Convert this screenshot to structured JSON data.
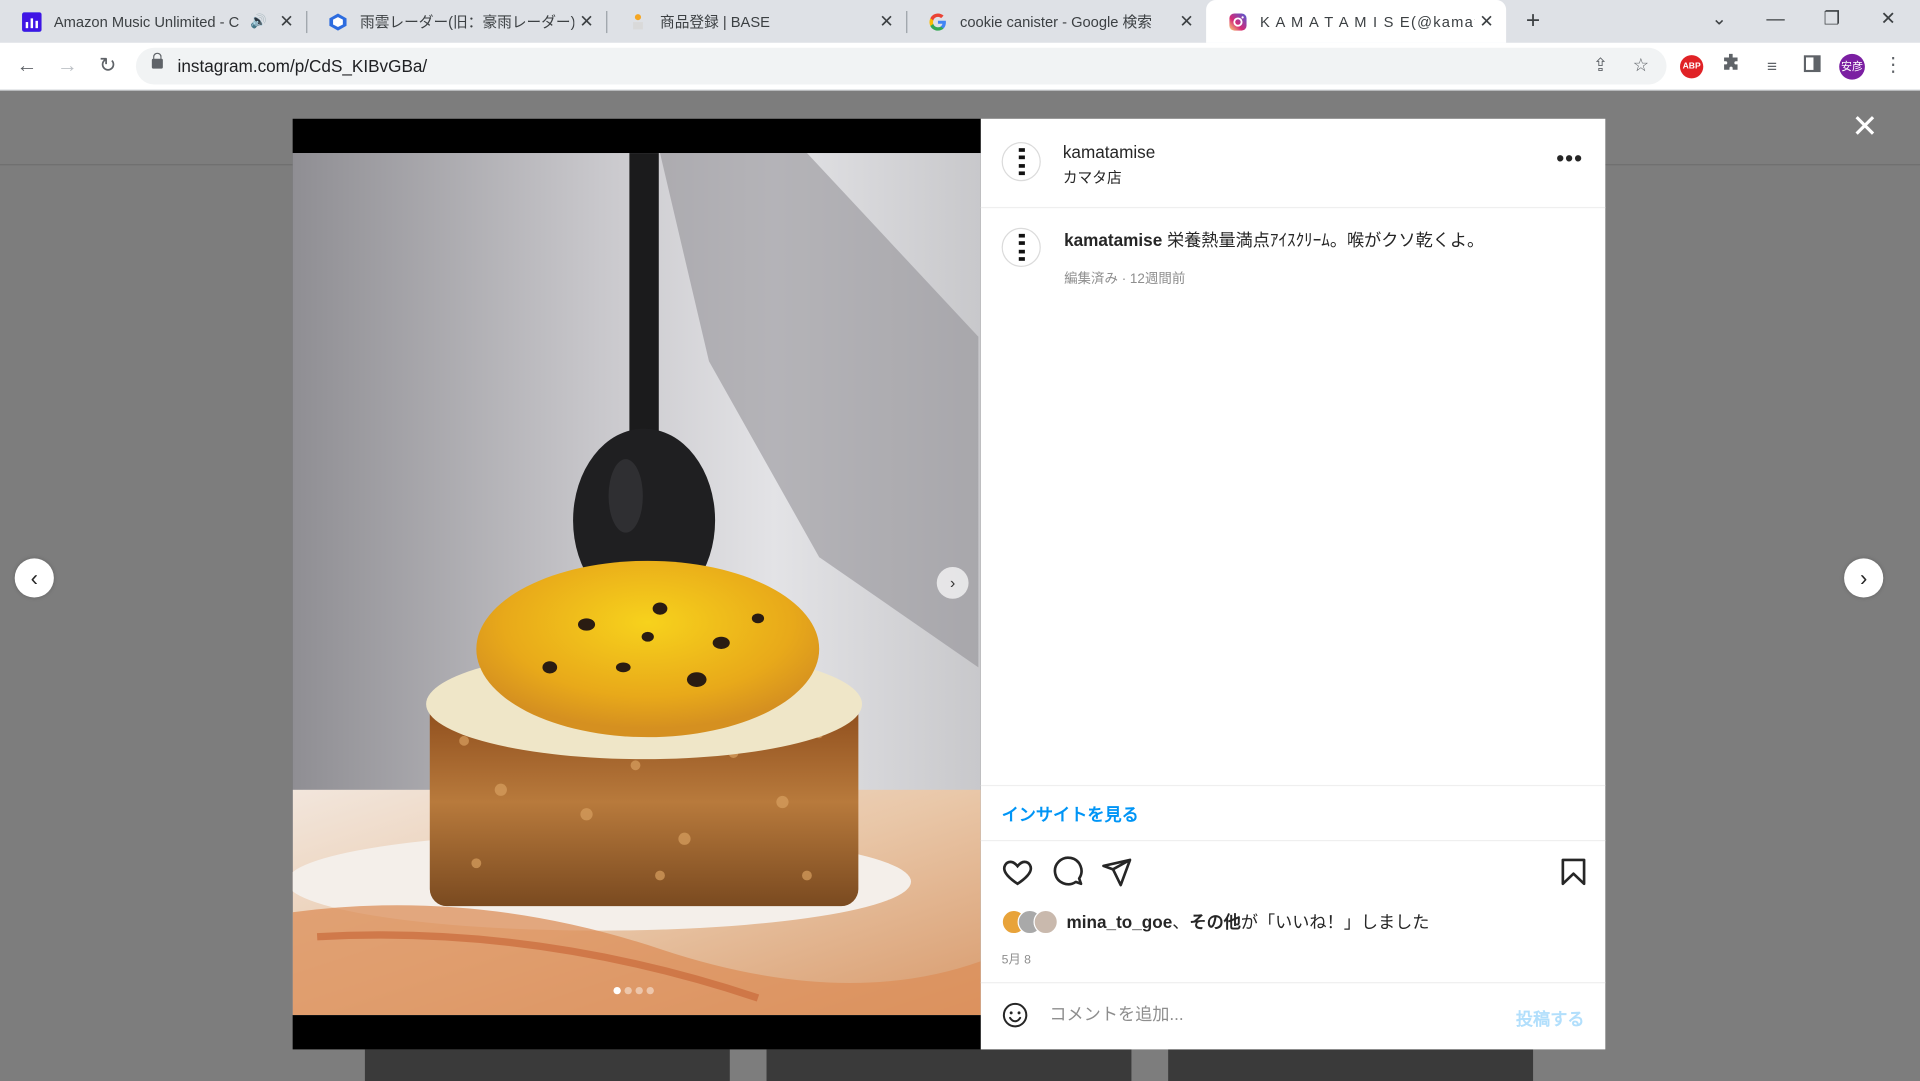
{
  "browser": {
    "tabs": [
      {
        "title": "Amazon Music Unlimited - C",
        "icon": "amazon-music-icon"
      },
      {
        "title": "雨雲レーダー(旧：豪雨レーダー) - 日本",
        "icon": "rain-radar-icon"
      },
      {
        "title": "商品登録 | BASE",
        "icon": "base-icon"
      },
      {
        "title": "cookie canister - Google 検索",
        "icon": "google-icon"
      },
      {
        "title": "K A M A T A M I S E(@kamatamise)",
        "icon": "instagram-icon"
      }
    ],
    "url": "instagram.com/p/CdS_KIBvGBa/",
    "profile_initials": "安彦",
    "abp_label": "ABP"
  },
  "post": {
    "username": "kamatamise",
    "location": "カマタ店",
    "caption_user": "kamatamise",
    "caption_text": "栄養熱量満点ｱｲｽｸﾘｰﾑ。喉がクソ乾くよ。",
    "edited": "編集済み",
    "time_ago": "12週間前",
    "insights_link": "インサイトを見る",
    "liked_by_user": "mina_to_goe",
    "liked_by_sep": "、",
    "liked_by_others": "その他",
    "liked_by_suffix": "が「いいね！」しました",
    "date": "5月 8",
    "comment_placeholder": "コメントを追加...",
    "post_button": "投稿する",
    "image_count": 4,
    "current_image": 1
  },
  "colors": {
    "link_blue": "#0095f6",
    "post_disabled": "#b2dffc",
    "overlay": "#7d7d7d"
  }
}
